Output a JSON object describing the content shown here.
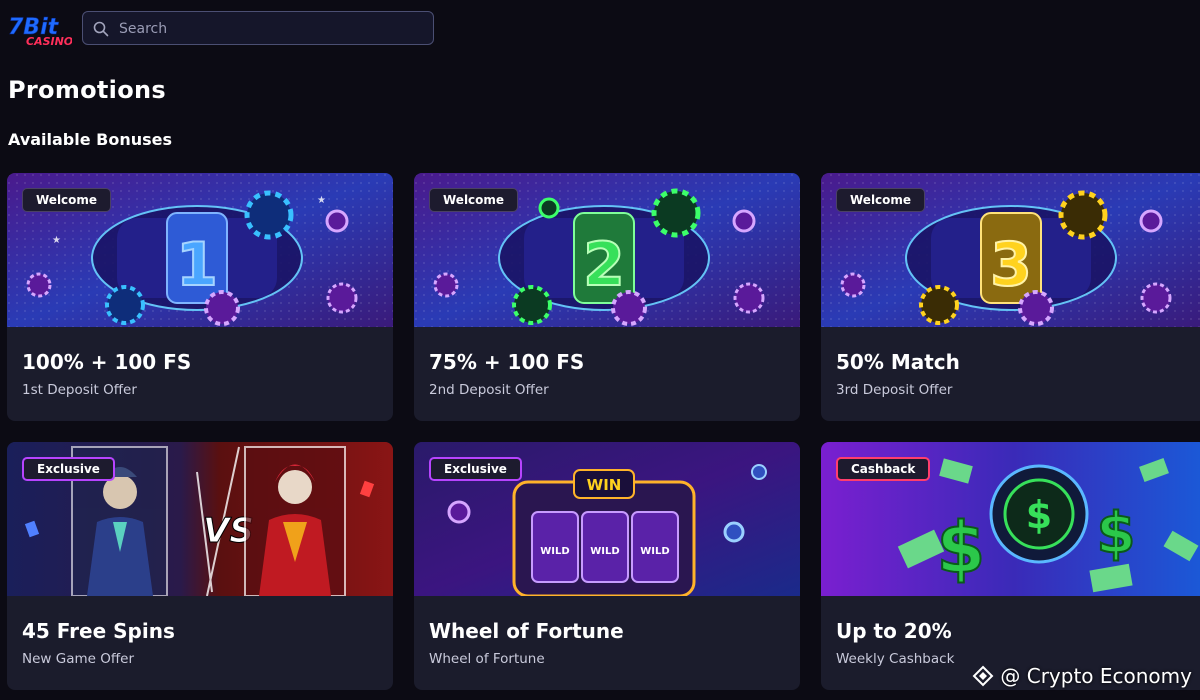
{
  "header": {
    "logo_text": "7Bit CASINO",
    "search_placeholder": "Search"
  },
  "page": {
    "title": "Promotions",
    "section_title": "Available Bonuses"
  },
  "cards": [
    {
      "badge": "Welcome",
      "title": "100% + 100 FS",
      "subtitle": "1st Deposit Offer",
      "art": "reel-1"
    },
    {
      "badge": "Welcome",
      "title": "75% + 100 FS",
      "subtitle": "2nd Deposit Offer",
      "art": "reel-2"
    },
    {
      "badge": "Welcome",
      "title": "50% Match",
      "subtitle": "3rd Deposit Offer",
      "art": "reel-3"
    },
    {
      "badge": "Exclusive",
      "title": "45 Free Spins",
      "subtitle": "New Game Offer",
      "art": "joker-vs"
    },
    {
      "badge": "Exclusive",
      "title": "Wheel of Fortune",
      "subtitle": "Wheel of Fortune",
      "art": "slot-machine"
    },
    {
      "badge": "Cashback",
      "title": "Up to 20%",
      "subtitle": "Weekly Cashback",
      "art": "dollar-cash"
    }
  ],
  "art_text": {
    "reel_1": "1",
    "reel_2": "2",
    "reel_3": "3",
    "vs": "VS",
    "win": "WIN",
    "wild": "WILD",
    "dollar": "$"
  },
  "watermark": {
    "text": "@ Crypto Economy"
  },
  "colors": {
    "background": "#0c0b14",
    "card": "#1b1c2c",
    "badge_exclusive_border": "#b744ff",
    "badge_cashback_border": "#ff3e6d"
  }
}
